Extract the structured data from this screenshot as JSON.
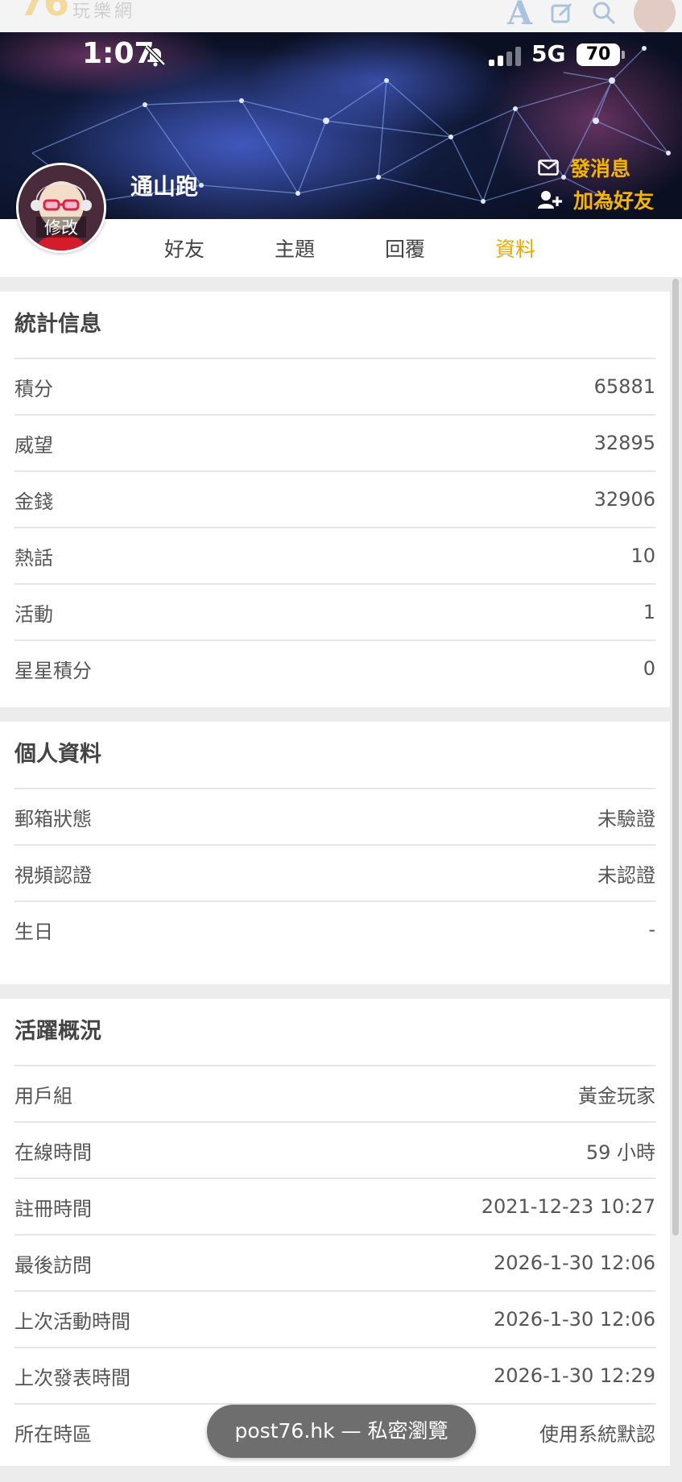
{
  "site_header": {
    "logo_number": "76",
    "logo_text": "玩樂網",
    "font_icon_label": "A"
  },
  "status_bar": {
    "time": "1:07",
    "network": "5G",
    "battery": "70"
  },
  "profile": {
    "username": "通山跑",
    "avatar_edit_label": "修改",
    "send_message_label": "發消息",
    "add_friend_label": "加為好友"
  },
  "tabs": [
    {
      "label": "好友",
      "active": false
    },
    {
      "label": "主題",
      "active": false
    },
    {
      "label": "回覆",
      "active": false
    },
    {
      "label": "資料",
      "active": true
    }
  ],
  "stats": {
    "title": "統計信息",
    "rows": [
      {
        "key": "積分",
        "value": "65881"
      },
      {
        "key": "威望",
        "value": "32895"
      },
      {
        "key": "金錢",
        "value": "32906"
      },
      {
        "key": "熱話",
        "value": "10"
      },
      {
        "key": "活動",
        "value": "1"
      },
      {
        "key": "星星積分",
        "value": "0"
      }
    ]
  },
  "personal": {
    "title": "個人資料",
    "rows": [
      {
        "key": "郵箱狀態",
        "value": "未驗證"
      },
      {
        "key": "視頻認證",
        "value": "未認證"
      },
      {
        "key": "生日",
        "value": "-"
      }
    ]
  },
  "activity": {
    "title": "活躍概況",
    "rows": [
      {
        "key": "用戶組",
        "value": "黃金玩家"
      },
      {
        "key": "在線時間",
        "value": "59 小時"
      },
      {
        "key": "註冊時間",
        "value": "2021-12-23 10:27"
      },
      {
        "key": "最後訪問",
        "value": "2026-1-30 12:06"
      },
      {
        "key": "上次活動時間",
        "value": "2026-1-30 12:06"
      },
      {
        "key": "上次發表時間",
        "value": "2026-1-30 12:29"
      },
      {
        "key": "所在時區",
        "value": "使用系統默認"
      }
    ]
  },
  "browser_pill": "post76.hk — 私密瀏覽",
  "colors": {
    "accent": "#f0a800",
    "banner_dark": "#0a0f22",
    "page_bg": "#ececec"
  }
}
